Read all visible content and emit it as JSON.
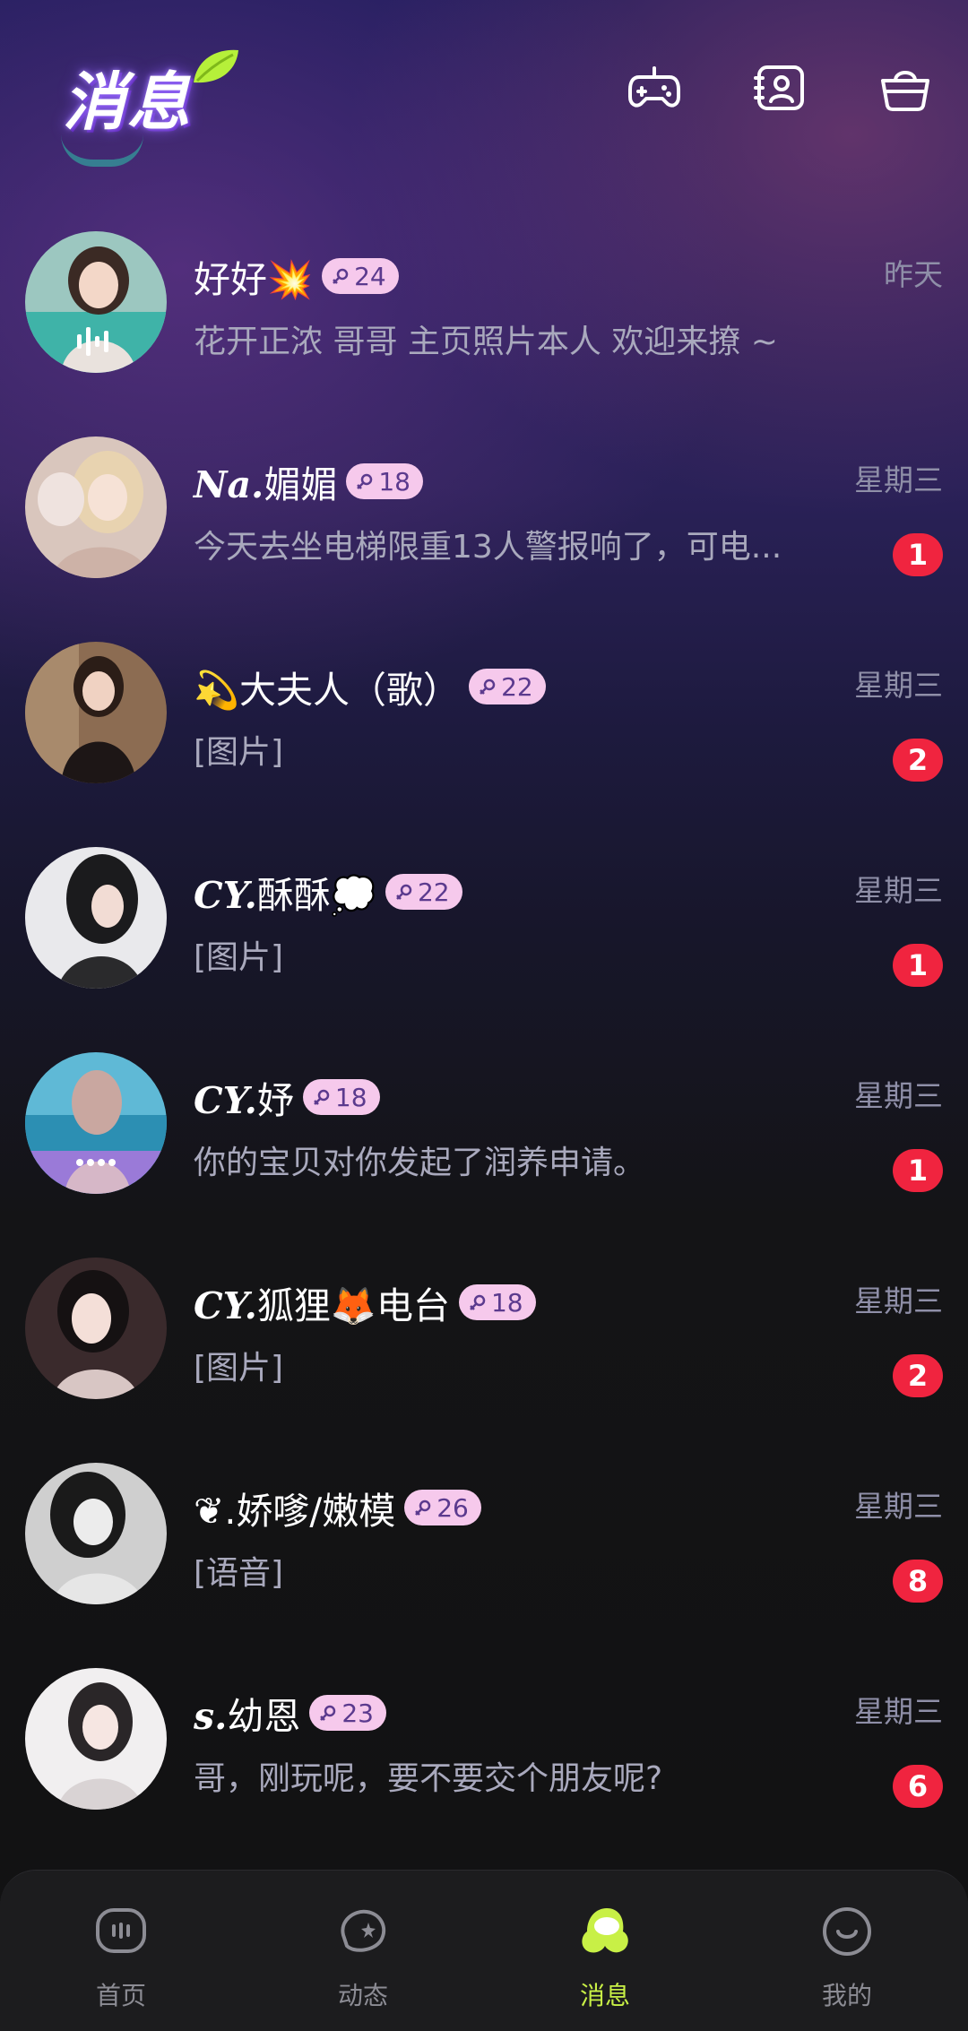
{
  "header": {
    "title": "消息",
    "icons": [
      "game-controller-icon",
      "contacts-card-icon",
      "shop-basket-icon"
    ]
  },
  "colors": {
    "badge": "#f0243f",
    "level_pill": "#f6c9ec",
    "active_tab": "#c8f046",
    "time_text": "#8f8fa8"
  },
  "conversations": [
    {
      "name_prefix": "",
      "name": "好好💥",
      "level": "24",
      "time": "昨天",
      "preview": "花开正浓 哥哥  主页照片本人  欢迎来撩 ~",
      "unread": ""
    },
    {
      "name_prefix": "Na.",
      "name": "媚媚",
      "level": "18",
      "time": "星期三",
      "preview": "今天去坐电梯限重13人警报响了，可电...",
      "unread": "1"
    },
    {
      "name_prefix": "",
      "name": "💫大夫人（歌）",
      "level": "22",
      "time": "星期三",
      "preview": "[图片]",
      "unread": "2"
    },
    {
      "name_prefix": "CY.",
      "name": "酥酥💭",
      "level": "22",
      "time": "星期三",
      "preview": "[图片]",
      "unread": "1"
    },
    {
      "name_prefix": "CY.",
      "name": "妤",
      "level": "18",
      "time": "星期三",
      "preview": "你的宝贝对你发起了润养申请。",
      "unread": "1"
    },
    {
      "name_prefix": "CY.",
      "name": "狐狸🦊电台",
      "level": "18",
      "time": "星期三",
      "preview": "[图片]",
      "unread": "2"
    },
    {
      "name_prefix": "",
      "name": "❦.娇嗲/嫩模",
      "level": "26",
      "time": "星期三",
      "preview": "[语音]",
      "unread": "8"
    },
    {
      "name_prefix": "s.",
      "name": "幼恩",
      "level": "23",
      "time": "星期三",
      "preview": "哥，刚玩呢，要不要交个朋友呢?",
      "unread": "6"
    }
  ],
  "tabs": [
    {
      "label": "首页",
      "icon": "home-icon"
    },
    {
      "label": "动态",
      "icon": "moments-icon"
    },
    {
      "label": "消息",
      "icon": "messages-icon",
      "active": true
    },
    {
      "label": "我的",
      "icon": "profile-icon"
    }
  ]
}
